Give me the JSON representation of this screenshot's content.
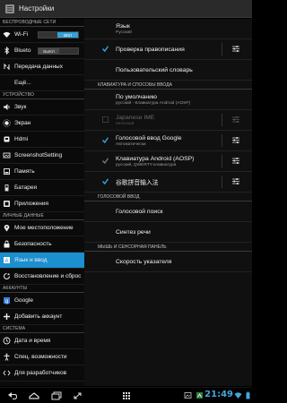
{
  "app": {
    "title": "Настройки"
  },
  "colors": {
    "accent": "#1b8fcf",
    "clock": "#42a8e0",
    "toggle_on": "#34a0d6"
  },
  "sidebar": {
    "sections": [
      {
        "header": "БЕСПРОВОДНЫЕ СЕТИ",
        "items": [
          {
            "label": "Wi-Fi",
            "icon": "wifi-icon",
            "toggle": "ВКЛ"
          },
          {
            "label": "Blueto",
            "icon": "bluetooth-icon",
            "toggle": "ВЫКЛ"
          },
          {
            "label": "Передача данных",
            "icon": "data-usage-icon"
          },
          {
            "label": "Ещё..."
          }
        ]
      },
      {
        "header": "УСТРОЙСТВО",
        "items": [
          {
            "label": "Звук",
            "icon": "sound-icon"
          },
          {
            "label": "Экран",
            "icon": "display-icon"
          },
          {
            "label": "Hdmi",
            "icon": "hdmi-icon"
          },
          {
            "label": "ScreenshotSetting",
            "icon": "screenshot-icon"
          },
          {
            "label": "Память",
            "icon": "storage-icon"
          },
          {
            "label": "Батарея",
            "icon": "battery-icon"
          },
          {
            "label": "Приложения",
            "icon": "apps-icon"
          }
        ]
      },
      {
        "header": "ЛИЧНЫЕ ДАННЫЕ",
        "items": [
          {
            "label": "Мое местоположение",
            "icon": "location-icon"
          },
          {
            "label": "Безопасность",
            "icon": "lock-icon"
          },
          {
            "label": "Язык и ввод",
            "icon": "language-icon",
            "selected": true
          },
          {
            "label": "Восстановление и сброс",
            "icon": "backup-icon"
          }
        ]
      },
      {
        "header": "АККАУНТЫ",
        "items": [
          {
            "label": "Google",
            "icon": "google-icon"
          },
          {
            "label": "Добавить аккаунт",
            "icon": "add-icon"
          }
        ]
      },
      {
        "header": "СИСТЕМА",
        "items": [
          {
            "label": "Дата и время",
            "icon": "clock-icon"
          },
          {
            "label": "Спец. возможности",
            "icon": "accessibility-icon"
          },
          {
            "label": "Для разработчиков",
            "icon": "developer-icon"
          }
        ]
      }
    ]
  },
  "main": {
    "blocks": [
      {
        "type": "item",
        "title": "Язык",
        "subtitle": "Русский",
        "h": 23
      },
      {
        "type": "item",
        "title": "Проверка правописания",
        "check": "on",
        "sliders": true,
        "h": 23
      },
      {
        "type": "item",
        "title": "Пользовательский словарь",
        "h": 23
      },
      {
        "type": "section",
        "text": "КЛАВИАТУРА И СПОСОБЫ ВВОДА"
      },
      {
        "type": "item",
        "title": "По умолчанию",
        "subtitle": "русский - Клавиатура Android (AOSP)",
        "h": 23
      },
      {
        "type": "item",
        "title": "Japanese IME",
        "subtitle": "японский",
        "check": "off",
        "sliders": true,
        "disabled": true,
        "h": 23
      },
      {
        "type": "item",
        "title": "Голосовой ввод Google",
        "subtitle": "Автоматически",
        "check": "on",
        "sliders": true,
        "h": 23
      },
      {
        "type": "item",
        "title": "Клавиатура Android (AOSP)",
        "subtitle": "русский, QWERTY-клавиатура",
        "check": "gray",
        "sliders": true,
        "h": 23
      },
      {
        "type": "item",
        "title": "谷歌拼音输入法",
        "check": "on",
        "sliders": true,
        "h": 23
      },
      {
        "type": "section",
        "text": "ГОЛОСОВОЙ ВВОД"
      },
      {
        "type": "item",
        "title": "Голосовой поиск",
        "h": 23
      },
      {
        "type": "item",
        "title": "Синтез речи",
        "h": 23
      },
      {
        "type": "section",
        "text": "МЫШЬ И СЕНСОРНАЯ ПАНЕЛЬ"
      },
      {
        "type": "item",
        "title": "Скорость указателя",
        "h": 23
      }
    ]
  },
  "statusbar": {
    "time": "21:49"
  }
}
